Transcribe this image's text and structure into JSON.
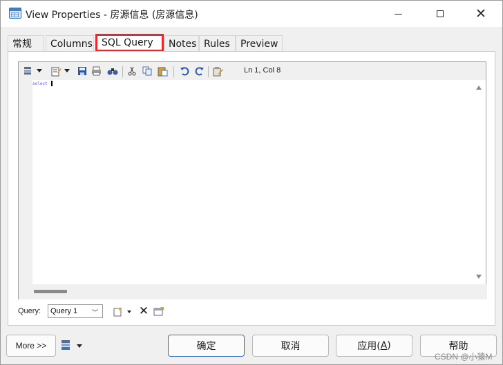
{
  "window": {
    "title": "View Properties - 房源信息 (房源信息)"
  },
  "tabs": [
    {
      "label": "常规"
    },
    {
      "label": "Columns"
    },
    {
      "label": "SQL Query"
    },
    {
      "label": "Notes"
    },
    {
      "label": "Rules"
    },
    {
      "label": "Preview"
    }
  ],
  "active_tab": "SQL Query",
  "editor": {
    "cursor_position": "Ln 1, Col 8",
    "content": "select"
  },
  "toolbar_icons": [
    "list-dropdown-icon",
    "edit-dropdown-icon",
    "save-icon",
    "print-icon",
    "find-icon",
    "cut-icon",
    "copy-icon",
    "paste-icon",
    "undo-icon",
    "redo-icon",
    "clipboard-edit-icon"
  ],
  "query": {
    "label": "Query:",
    "selected": "Query 1"
  },
  "buttons": {
    "more": "More >>",
    "ok": "确定",
    "cancel": "取消",
    "apply_text": "应用(",
    "apply_key": "A",
    "apply_end": ")",
    "help": "帮助"
  },
  "watermark": "CSDN @小猿M",
  "colors": {
    "highlight_border": "#e8292b",
    "ok_border": "#2f6fc4",
    "syntax_keyword": "#5a5aff"
  }
}
